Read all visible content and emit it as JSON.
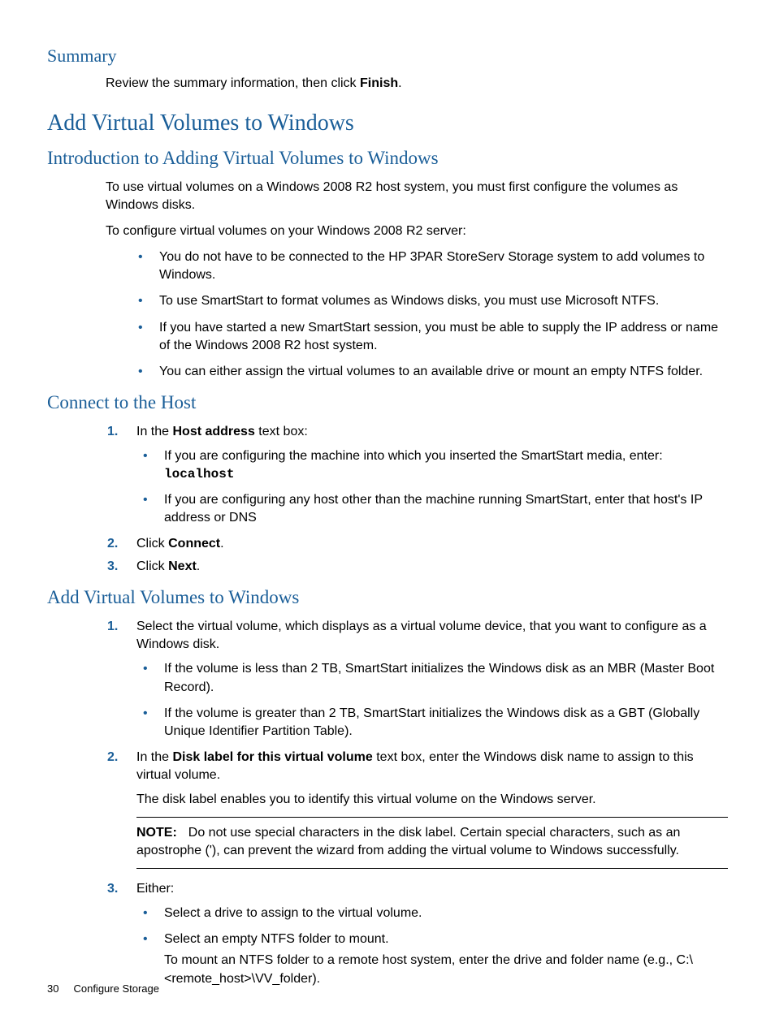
{
  "summary": {
    "heading": "Summary",
    "text_pre": "Review the summary information, then click ",
    "text_bold": "Finish",
    "text_post": "."
  },
  "add_vv": {
    "heading": "Add Virtual Volumes to Windows"
  },
  "intro": {
    "heading": "Introduction to Adding Virtual Volumes to Windows",
    "p1": "To use virtual volumes on a Windows 2008 R2 host system, you must first configure the volumes as Windows disks.",
    "p2": "To configure virtual volumes on your Windows 2008 R2 server:",
    "bullets": {
      "b1": "You do not have to be connected to the HP 3PAR StoreServ Storage system to add volumes to Windows.",
      "b2": "To use SmartStart to format volumes as Windows disks, you must use Microsoft NTFS.",
      "b3": "If you have started a new SmartStart session, you must be able to supply the IP address or name of the Windows 2008 R2 host system.",
      "b4": "You can either assign the virtual volumes to an available drive or mount an empty NTFS folder."
    }
  },
  "connect": {
    "heading": "Connect to the Host",
    "step1_pre": "In the ",
    "step1_bold": "Host address",
    "step1_post": " text box:",
    "step1_sub": {
      "a_pre": "If you are configuring the machine into which you inserted the SmartStart media, enter: ",
      "a_mono": "localhost",
      "b": "If you are configuring any host other than the machine running SmartStart, enter that host's IP address or DNS"
    },
    "step2_pre": "Click ",
    "step2_bold": "Connect",
    "step2_post": ".",
    "step3_pre": "Click ",
    "step3_bold": "Next",
    "step3_post": "."
  },
  "add_section": {
    "heading": "Add Virtual Volumes to Windows",
    "step1": "Select the virtual volume, which displays as a virtual volume device, that you want to configure as a Windows disk.",
    "step1_sub": {
      "a": "If the volume is less than 2 TB, SmartStart initializes the Windows disk as an MBR (Master Boot Record).",
      "b": "If the volume is greater than 2 TB, SmartStart initializes the Windows disk as a GBT (Globally Unique Identifier Partition Table)."
    },
    "step2_pre": "In the ",
    "step2_bold": "Disk label for this virtual volume",
    "step2_post": " text box, enter the Windows disk name to assign to this virtual volume.",
    "step2_p2": "The disk label enables you to identify this virtual volume on the Windows server.",
    "note_label": "NOTE:",
    "note_body": "Do not use special characters in the disk label. Certain special characters, such as an apostrophe ('), can prevent the wizard from adding the virtual volume to Windows successfully.",
    "step3": "Either:",
    "step3_sub": {
      "a": "Select a drive to assign to the virtual volume.",
      "b": "Select an empty NTFS folder to mount.",
      "b_p2": "To mount an NTFS folder to a remote host system, enter the drive and folder name (e.g., C:\\<remote_host>\\VV_folder)."
    }
  },
  "footer": {
    "page_number": "30",
    "section": "Configure Storage"
  }
}
